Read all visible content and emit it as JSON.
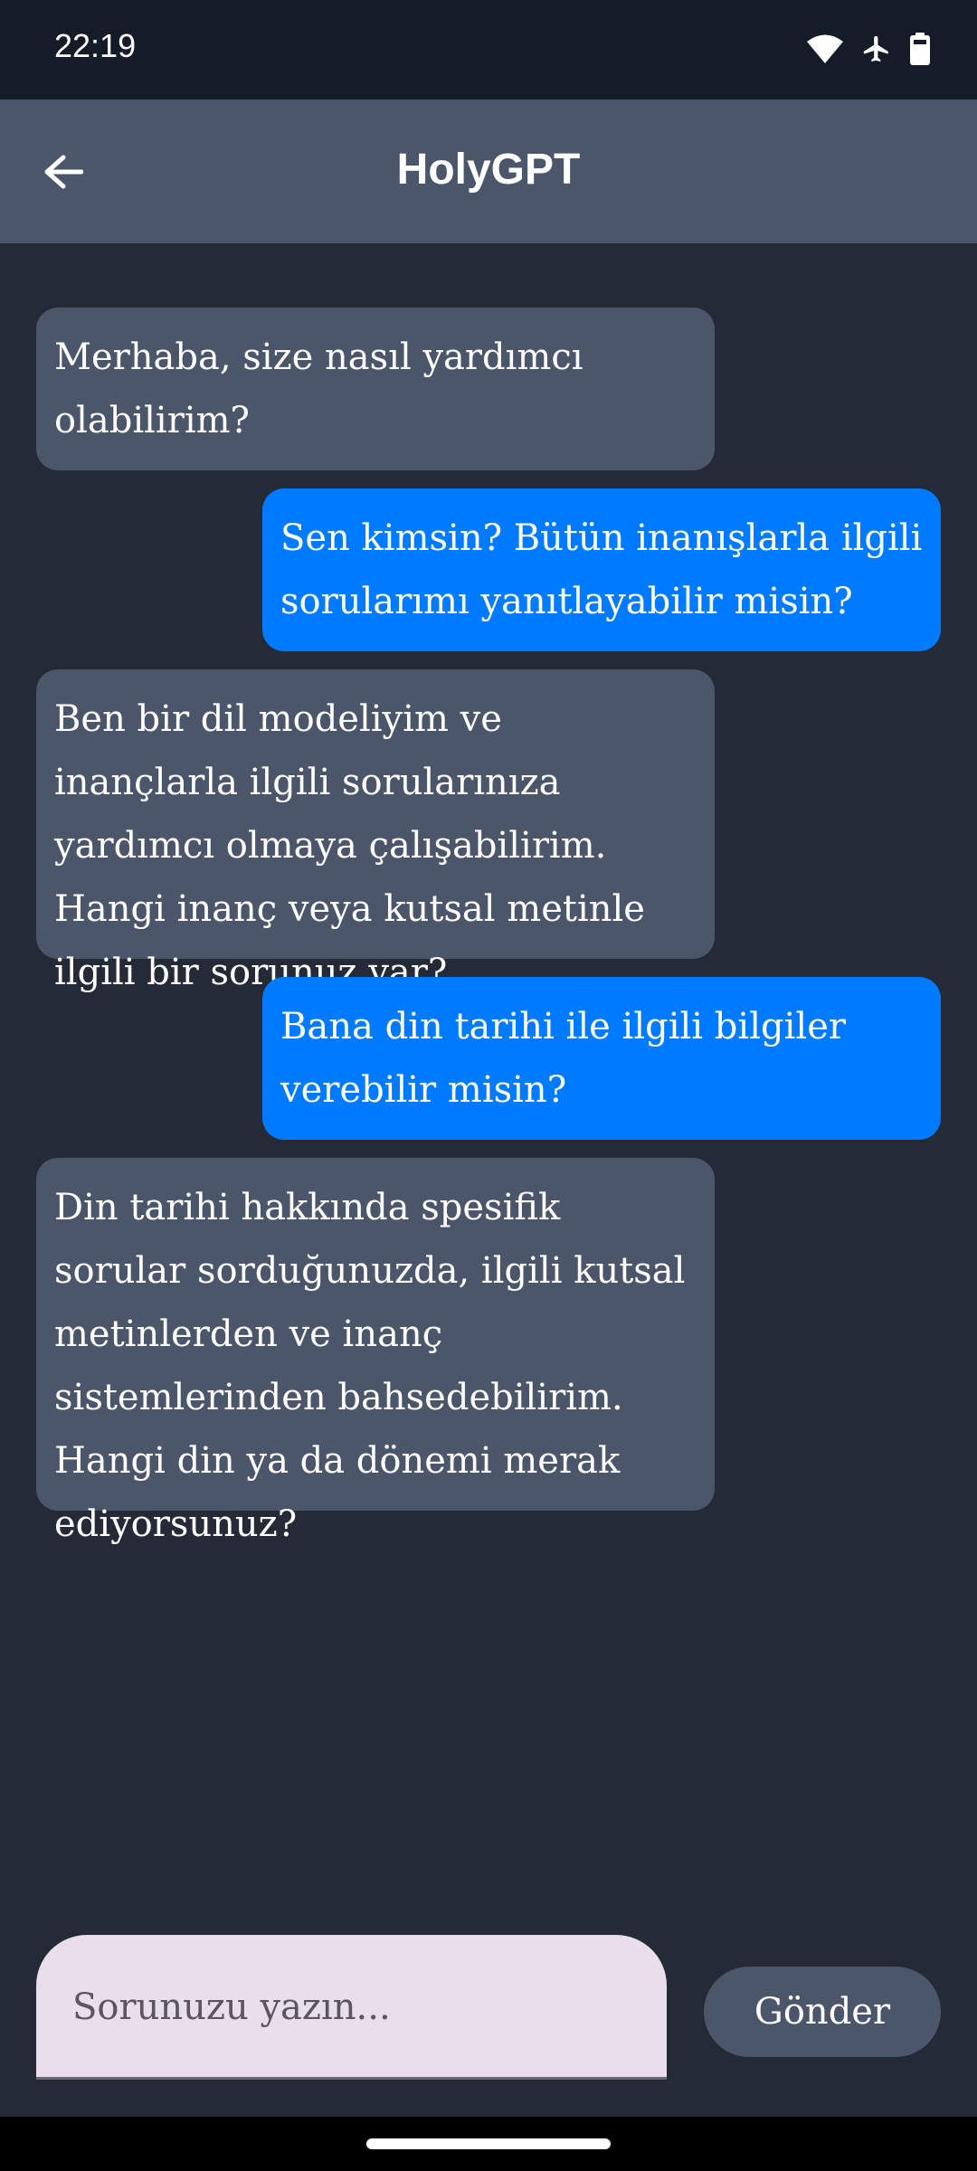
{
  "status_bar": {
    "time": "22:19",
    "icons": [
      "wifi-icon",
      "airplane-mode-icon",
      "battery-icon"
    ]
  },
  "app_bar": {
    "title": "HolyGPT",
    "back_icon": "arrow-left-icon"
  },
  "messages": [
    {
      "sender": "bot",
      "text": "Merhaba, size nasıl yardımcı olabilirim?"
    },
    {
      "sender": "user",
      "text": "Sen kimsin? Bütün inanışlarla ilgili sorularımı yanıtlayabilir misin?"
    },
    {
      "sender": "bot",
      "text": "Ben bir dil modeliyim ve inançlarla ilgili sorularınıza yardımcı olmaya çalışabilirim. Hangi inanç veya kutsal metinle ilgili bir sorunuz var?"
    },
    {
      "sender": "user",
      "text": "Bana din tarihi ile ilgili bilgiler verebilir misin?"
    },
    {
      "sender": "bot",
      "text": "Din tarihi hakkında spesifik sorular sorduğunuzda, ilgili kutsal metinlerden ve inanç sistemlerinden bahsedebilirim. Hangi din ya da dönemi merak ediyorsunuz?"
    }
  ],
  "input": {
    "placeholder": "Sorunuzu yazın...",
    "value": ""
  },
  "send_button": {
    "label": "Gönder"
  },
  "colors": {
    "background": "#252b36",
    "status_bar": "#141c27",
    "app_bar": "#4c566a",
    "bot_bubble": "#4c566a",
    "user_bubble": "#007bff",
    "input_field": "#e8dfea"
  }
}
